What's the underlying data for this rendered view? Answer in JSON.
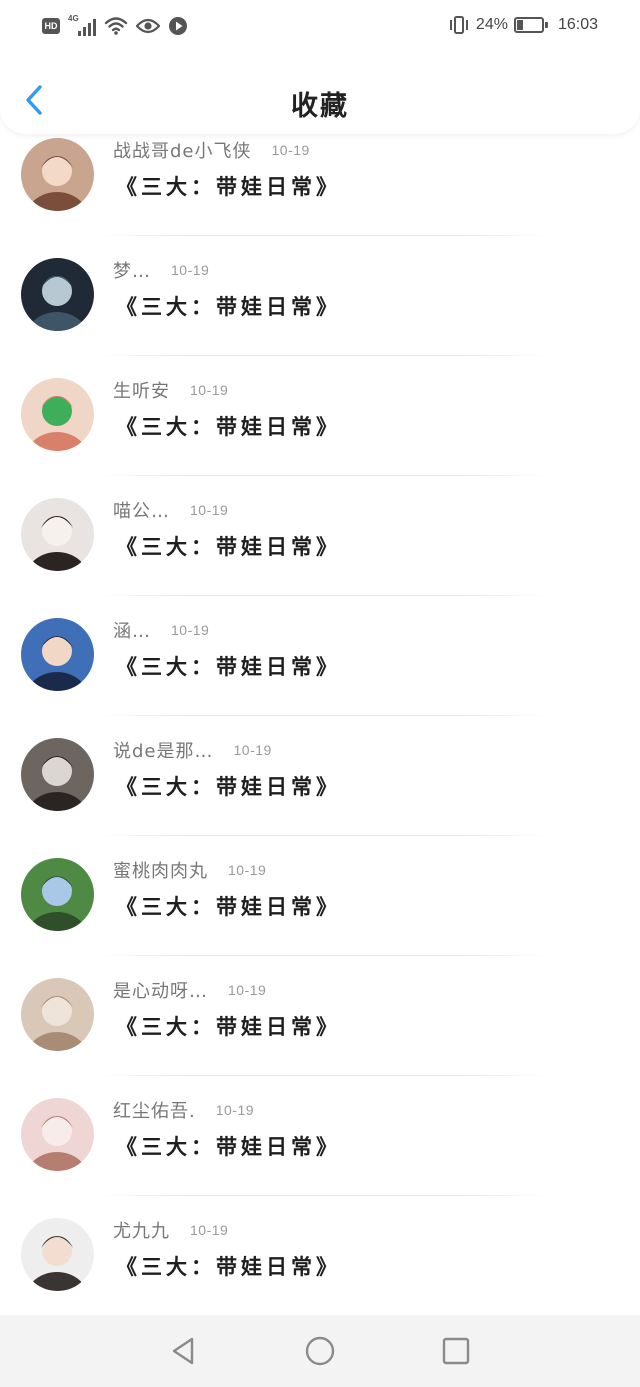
{
  "status_bar": {
    "hd_label": "HD",
    "network_label": "4G",
    "battery_percent_text": "24%",
    "battery_level": 0.24,
    "time": "16:03",
    "icons": [
      "hd-icon",
      "cellular-signal-icon",
      "wifi-icon",
      "eye-icon",
      "play-icon",
      "vibrate-icon",
      "battery-icon"
    ]
  },
  "nav": {
    "title": "收藏",
    "back_icon": "chevron-left-icon",
    "accent_color": "#2f9af1"
  },
  "favorites": [
    {
      "name": "战战哥de小飞侠",
      "date": "10-19",
      "title": "《三大：带娃日常》"
    },
    {
      "name": "梦…",
      "date": "10-19",
      "title": "《三大：带娃日常》"
    },
    {
      "name": "生听安",
      "date": "10-19",
      "title": "《三大：带娃日常》"
    },
    {
      "name": "喵公…",
      "date": "10-19",
      "title": "《三大：带娃日常》"
    },
    {
      "name": "涵…",
      "date": "10-19",
      "title": "《三大：带娃日常》"
    },
    {
      "name": "说de是那…",
      "date": "10-19",
      "title": "《三大：带娃日常》"
    },
    {
      "name": "蜜桃肉肉丸",
      "date": "10-19",
      "title": "《三大：带娃日常》"
    },
    {
      "name": "是心动呀…",
      "date": "10-19",
      "title": "《三大：带娃日常》"
    },
    {
      "name": "红尘佑吾.",
      "date": "10-19",
      "title": "《三大：带娃日常》"
    },
    {
      "name": "尤九九",
      "date": "10-19",
      "title": "《三大：带娃日常》"
    }
  ],
  "system_nav": {
    "icons": [
      "back-triangle-icon",
      "home-circle-icon",
      "recents-square-icon"
    ]
  }
}
